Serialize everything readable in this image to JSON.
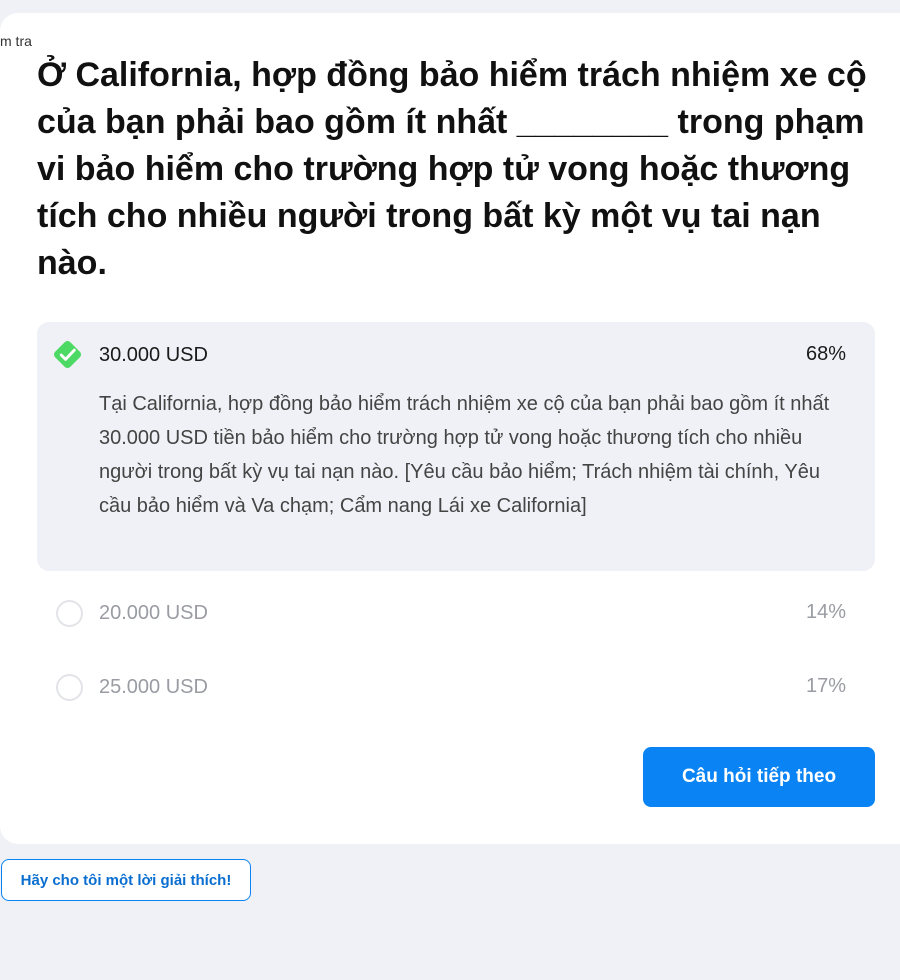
{
  "header": {
    "corner_label": "m tra"
  },
  "question": {
    "text": "Ở California, hợp đồng bảo hiểm trách nhiệm xe cộ của bạn phải bao gồm ít nhất ________ trong phạm vi bảo hiểm cho trường hợp tử vong hoặc thương tích cho nhiều người trong bất kỳ một vụ tai nạn nào."
  },
  "options": [
    {
      "label": "30.000 USD",
      "percent": "68%",
      "state": "correct-selected",
      "icon": "check-diamond-icon",
      "explanation": "Tại California, hợp đồng bảo hiểm trách nhiệm xe cộ của bạn phải bao gồm ít nhất 30.000 USD tiền bảo hiểm cho trường hợp tử vong hoặc thương tích cho nhiều người trong bất kỳ vụ tai nạn nào. [Yêu cầu bảo hiểm; Trách nhiệm tài chính, Yêu cầu bảo hiểm và Va chạm; Cẩm nang Lái xe California]"
    },
    {
      "label": "20.000 USD",
      "percent": "14%",
      "state": "unselected",
      "icon": "radio-empty-icon"
    },
    {
      "label": "25.000 USD",
      "percent": "17%",
      "state": "unselected",
      "icon": "radio-empty-icon"
    }
  ],
  "actions": {
    "next_label": "Câu hỏi tiếp theo",
    "explain_label": "Hãy cho tôi một lời giải thích!"
  },
  "colors": {
    "accent_blue": "#0a84f5",
    "correct_green": "#4cd964",
    "page_background": "#f0f1f6",
    "card_background": "#ffffff"
  }
}
